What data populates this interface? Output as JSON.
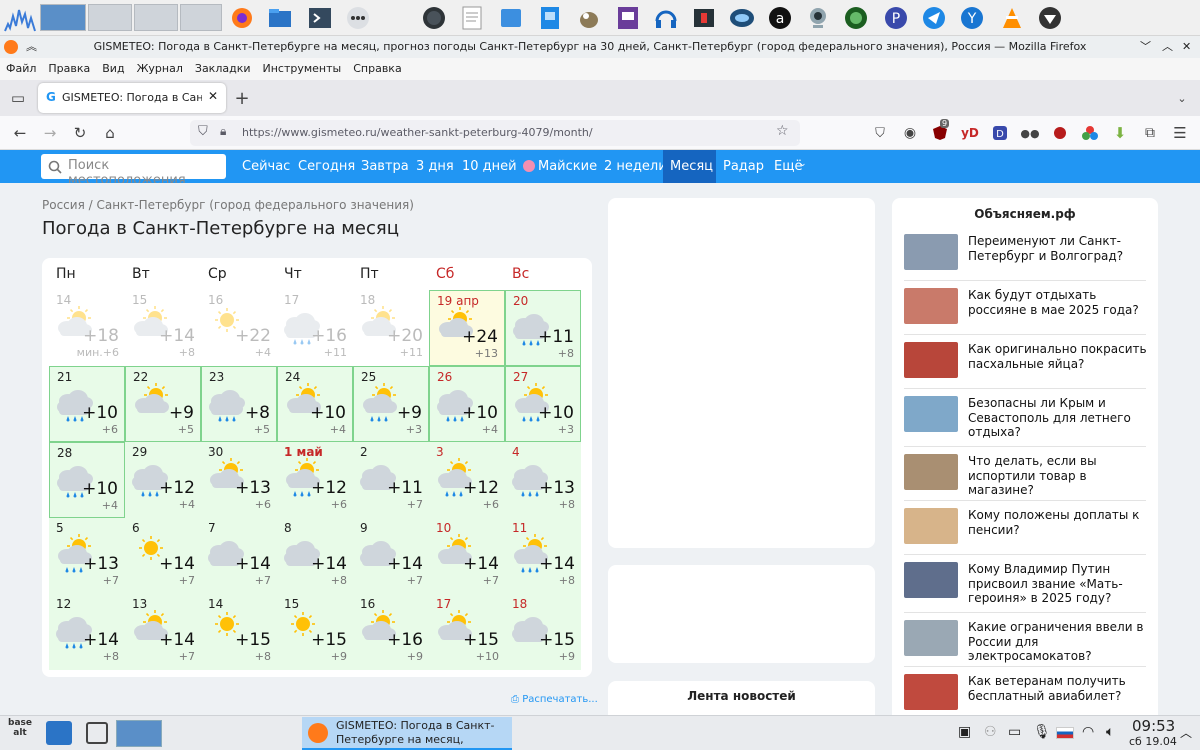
{
  "window": {
    "title": "GISMETEO: Погода в Санкт-Петербурге на месяц, прогноз погоды Санкт-Петербург на 30 дней, Санкт-Петербург (город федерального значения), Россия — Mozilla Firefox"
  },
  "menu": [
    "Файл",
    "Правка",
    "Вид",
    "Журнал",
    "Закладки",
    "Инструменты",
    "Справка"
  ],
  "tab": {
    "label": "GISMETEO: Погода в Санкт-Пет",
    "favicon": "G"
  },
  "address": {
    "url": "https://www.gismeteo.ru/weather-sankt-peterburg-4079/month/"
  },
  "ext": {
    "badge": "9",
    "yd": "yD"
  },
  "site_nav": {
    "search_placeholder": "Поиск местоположения",
    "items": [
      "Сейчас",
      "Сегодня",
      "Завтра",
      "3 дня",
      "10 дней",
      "Майские",
      "2 недели",
      "Месяц",
      "Радар",
      "Ещё"
    ],
    "active": "Месяц"
  },
  "breadcrumb": "Россия / Санкт-Петербург (город федерального значения)",
  "page_title": "Погода в Санкт-Петербурге на месяц",
  "weekdays": [
    "Пн",
    "Вт",
    "Ср",
    "Чт",
    "Пт",
    "Сб",
    "Вс"
  ],
  "calendar": [
    [
      {
        "d": "14",
        "max": "+18",
        "min": "мин.+6",
        "past": true,
        "icon": "pc"
      },
      {
        "d": "15",
        "max": "+14",
        "min": "+8",
        "past": true,
        "icon": "pc"
      },
      {
        "d": "16",
        "max": "+22",
        "min": "+4",
        "past": true,
        "icon": "sun"
      },
      {
        "d": "17",
        "max": "+16",
        "min": "+11",
        "past": true,
        "icon": "rain"
      },
      {
        "d": "18",
        "max": "+20",
        "min": "+11",
        "past": true,
        "icon": "pc"
      },
      {
        "d": "19 апр",
        "max": "+24",
        "min": "+13",
        "today": true,
        "icon": "pc"
      },
      {
        "d": "20",
        "max": "+11",
        "min": "+8",
        "icon": "rain"
      }
    ],
    [
      {
        "d": "21",
        "max": "+10",
        "min": "+6",
        "icon": "rain"
      },
      {
        "d": "22",
        "max": "+9",
        "min": "+5",
        "icon": "pc"
      },
      {
        "d": "23",
        "max": "+8",
        "min": "+5",
        "icon": "rain"
      },
      {
        "d": "24",
        "max": "+10",
        "min": "+4",
        "icon": "pc"
      },
      {
        "d": "25",
        "max": "+9",
        "min": "+3",
        "icon": "pcr"
      },
      {
        "d": "26",
        "max": "+10",
        "min": "+4",
        "icon": "rain"
      },
      {
        "d": "27",
        "max": "+10",
        "min": "+3",
        "icon": "pcr"
      }
    ],
    [
      {
        "d": "28",
        "max": "+10",
        "min": "+4",
        "icon": "rain"
      },
      {
        "d": "29",
        "max": "+12",
        "min": "+4",
        "icon": "rain"
      },
      {
        "d": "30",
        "max": "+13",
        "min": "+6",
        "icon": "pc"
      },
      {
        "d": "1 май",
        "max": "+12",
        "min": "+6",
        "holiday": true,
        "icon": "pcr"
      },
      {
        "d": "2",
        "max": "+11",
        "min": "+7",
        "icon": "cloud"
      },
      {
        "d": "3",
        "max": "+12",
        "min": "+6",
        "icon": "pcr"
      },
      {
        "d": "4",
        "max": "+13",
        "min": "+8",
        "icon": "rain"
      }
    ],
    [
      {
        "d": "5",
        "max": "+13",
        "min": "+7",
        "icon": "pcr"
      },
      {
        "d": "6",
        "max": "+14",
        "min": "+7",
        "icon": "sun"
      },
      {
        "d": "7",
        "max": "+14",
        "min": "+7",
        "icon": "cloud"
      },
      {
        "d": "8",
        "max": "+14",
        "min": "+8",
        "icon": "cloud"
      },
      {
        "d": "9",
        "max": "+14",
        "min": "+7",
        "icon": "cloud"
      },
      {
        "d": "10",
        "max": "+14",
        "min": "+7",
        "icon": "pc"
      },
      {
        "d": "11",
        "max": "+14",
        "min": "+8",
        "icon": "pcr"
      }
    ],
    [
      {
        "d": "12",
        "max": "+14",
        "min": "+8",
        "icon": "rain"
      },
      {
        "d": "13",
        "max": "+14",
        "min": "+7",
        "icon": "pc"
      },
      {
        "d": "14",
        "max": "+15",
        "min": "+8",
        "icon": "sun"
      },
      {
        "d": "15",
        "max": "+15",
        "min": "+9",
        "icon": "sun"
      },
      {
        "d": "16",
        "max": "+16",
        "min": "+9",
        "icon": "pc"
      },
      {
        "d": "17",
        "max": "+15",
        "min": "+10",
        "icon": "pc"
      },
      {
        "d": "18",
        "max": "+15",
        "min": "+9",
        "icon": "cloud"
      }
    ]
  ],
  "print_link": "Распечатать...",
  "news_feed_title": "Лента новостей",
  "side": {
    "title": "Объясняем.рф",
    "items": [
      "Переименуют ли Санкт-Петербург и Волгоград?",
      "Как будут отдыхать россияне в мае 2025 года?",
      "Как оригинально покрасить пасхальные яйца?",
      "Безопасны ли Крым и Севастополь для летнего отдыха?",
      "Что делать, если вы испортили товар в магазине?",
      "Кому положены доплаты к пенсии?",
      "Кому Владимир Путин присвоил звание «Мать-героиня» в 2025 году?",
      "Какие ограничения ввели в России для электросамокатов?",
      "Как ветеранам получить бесплатный авиабилет?"
    ],
    "thumb_colors": [
      "#8a9bb0",
      "#c97a6a",
      "#b8463a",
      "#7fa8c9",
      "#a98f72",
      "#d7b48a",
      "#5f6e8c",
      "#9aa8b4",
      "#c04a3e"
    ]
  },
  "taskbar": {
    "window_label": "GISMETEO: Погода в Санкт-Петербурге на месяц, прогноз пог…",
    "time": "09:53",
    "date": "сб 19.04",
    "base_logo": "base alt"
  },
  "colors": {
    "accent": "#2196f3",
    "holiday": "#c62828",
    "month_bg": "#e8fbe8",
    "today_bg": "#fdfbe0",
    "cell_border": "#7fd38d"
  }
}
